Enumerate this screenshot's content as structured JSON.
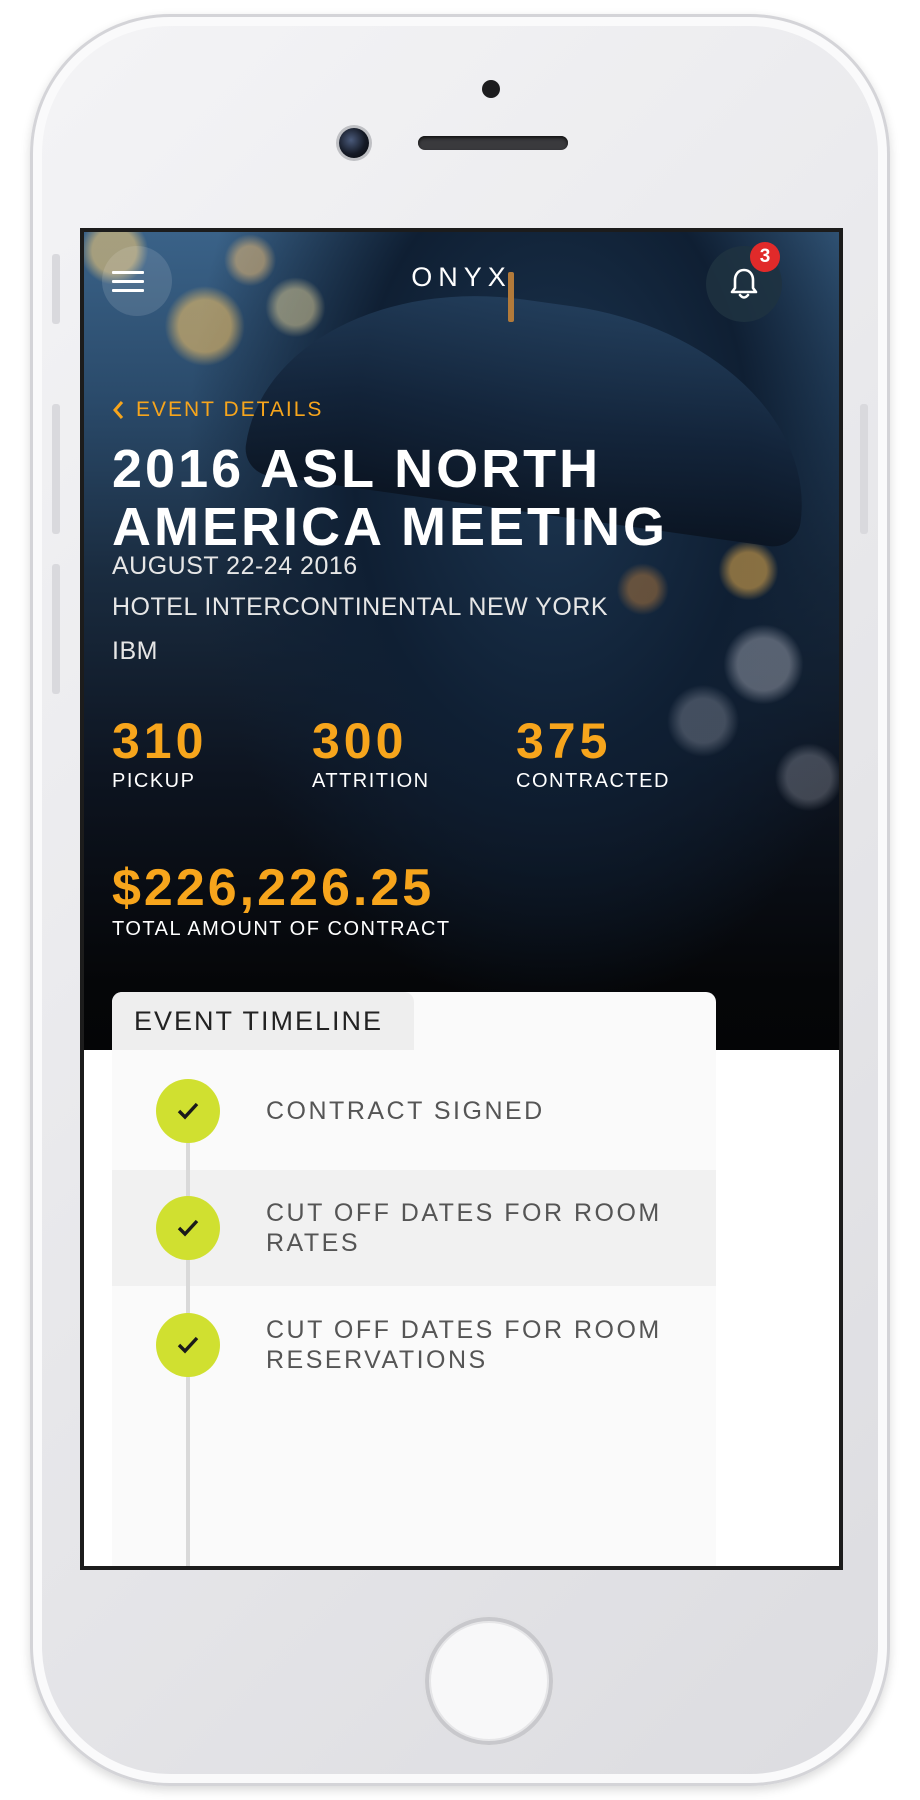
{
  "app": {
    "brand": "ONYX",
    "notification_count": "3"
  },
  "header": {
    "back_label": "EVENT DETAILS"
  },
  "event": {
    "title": "2016 ASL NORTH AMERICA MEETING",
    "dates": "AUGUST 22-24 2016",
    "venue": "HOTEL INTERCONTINENTAL NEW YORK",
    "client": "IBM"
  },
  "stats": [
    {
      "value": "310",
      "label": "PICKUP"
    },
    {
      "value": "300",
      "label": "ATTRITION"
    },
    {
      "value": "375",
      "label": "CONTRACTED"
    }
  ],
  "total": {
    "value": "$226,226.25",
    "label": "TOTAL AMOUNT OF CONTRACT"
  },
  "timeline": {
    "tab_label": "EVENT TIMELINE",
    "items": [
      {
        "label": "CONTRACT SIGNED",
        "status": "done"
      },
      {
        "label": "CUT OFF DATES FOR ROOM RATES",
        "status": "done"
      },
      {
        "label": "CUT OFF DATES FOR ROOM RESERVATIONS",
        "status": "done"
      }
    ]
  },
  "colors": {
    "accent": "#f7a51c",
    "check": "#d0e030",
    "badge": "#e12a2a"
  }
}
